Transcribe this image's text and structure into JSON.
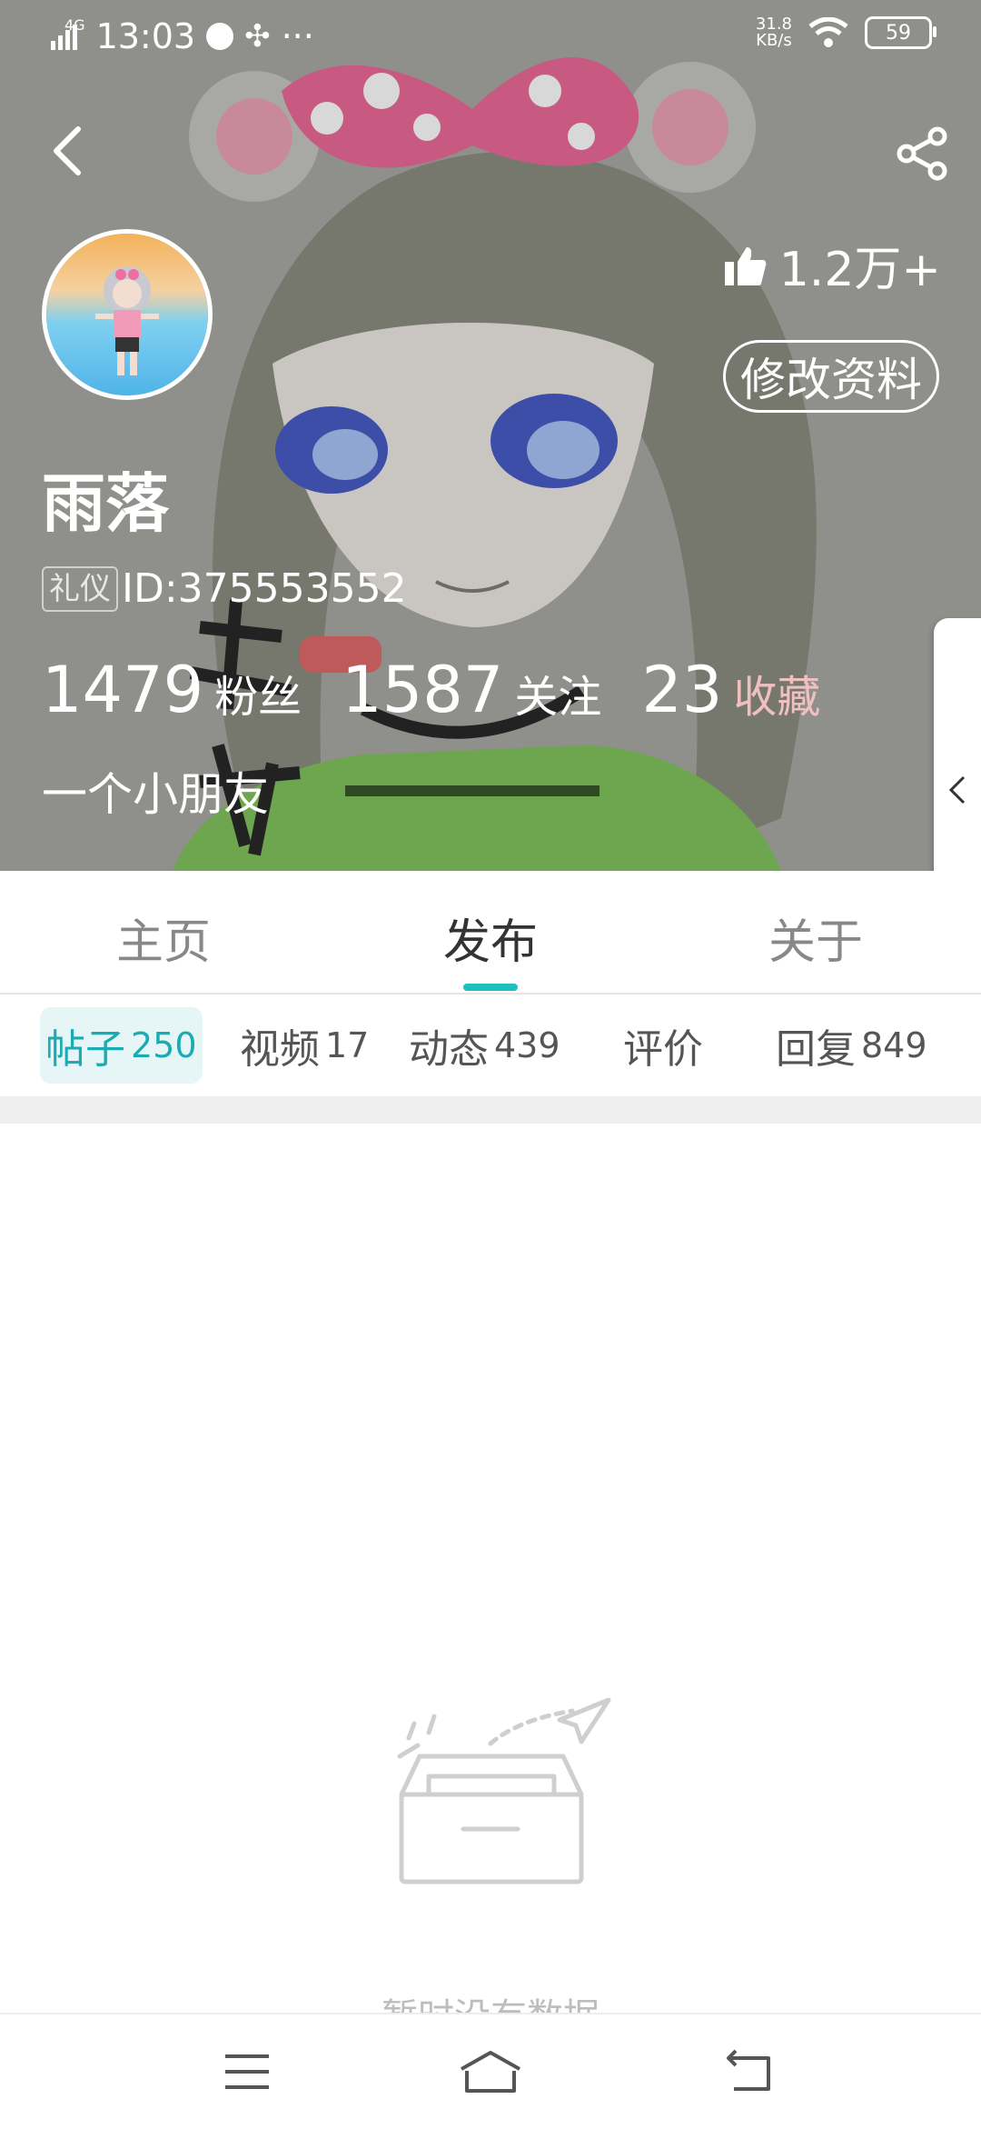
{
  "status_bar": {
    "network": "4G",
    "time": "13:03",
    "more": "···",
    "speed_value": "31.8",
    "speed_unit": "KB/s",
    "battery": "59"
  },
  "profile": {
    "likes": "1.2万+",
    "edit_label": "修改资料",
    "nickname": "雨落",
    "id_tag": "礼仪",
    "id_text": "ID:375553552",
    "stats": [
      {
        "value": "1479",
        "label": "粉丝"
      },
      {
        "value": "1587",
        "label": "关注"
      },
      {
        "value": "23",
        "label": "收藏"
      }
    ],
    "bio": "一个小朋友"
  },
  "main_tabs": [
    {
      "label": "主页"
    },
    {
      "label": "发布"
    },
    {
      "label": "关于"
    }
  ],
  "sub_tabs": [
    {
      "label": "帖子",
      "count": "250"
    },
    {
      "label": "视频",
      "count": "17"
    },
    {
      "label": "动态",
      "count": "439"
    },
    {
      "label": "评价",
      "count": ""
    },
    {
      "label": "回复",
      "count": "849"
    }
  ],
  "empty_state": {
    "text": "暂时没有数据"
  },
  "colors": {
    "accent": "#1dbfbf",
    "cover_gray": "#8f8f8b",
    "stat_red": "#f0c0c0"
  },
  "icons": [
    "back-arrow-icon",
    "share-icon",
    "thumbs-up-icon",
    "collapse-chevron-icon",
    "empty-inbox-icon",
    "menu-icon",
    "home-icon",
    "back-icon"
  ]
}
